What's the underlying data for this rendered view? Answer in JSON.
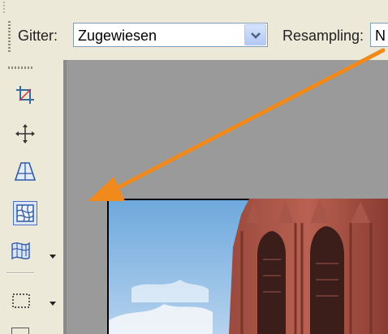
{
  "toolbar": {
    "grid_label": "Gitter:",
    "grid_value": "Zugewiesen",
    "resampling_label": "Resampling:",
    "resampling_value": "N"
  },
  "tools": [
    {
      "name": "crop-tool",
      "icon": "crop-icon"
    },
    {
      "name": "move-tool",
      "icon": "move-arrows-icon"
    },
    {
      "name": "perspective-tool",
      "icon": "perspective-icon",
      "active": false
    },
    {
      "name": "mesh-warp-tool",
      "icon": "mesh-warp-icon",
      "active": true
    },
    {
      "name": "envelope-tool",
      "icon": "envelope-distort-icon"
    },
    {
      "name": "marquee-tool",
      "icon": "rectangle-selection-icon"
    }
  ],
  "colors": {
    "arrow": "#f08a1c",
    "ui_background": "#ece9d8",
    "canvas_background": "#9a9a9a",
    "combo_border": "#7f9db9"
  }
}
